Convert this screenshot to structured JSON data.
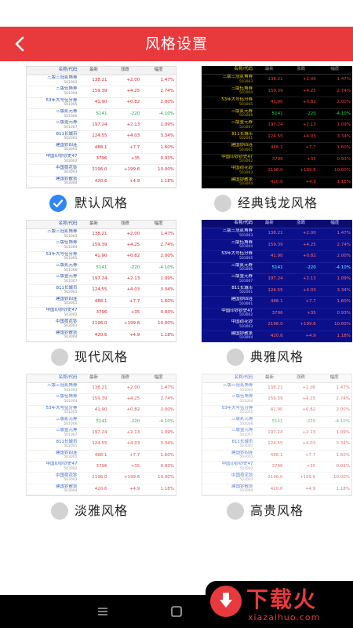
{
  "header": {
    "title": "风格设置",
    "back_icon": "chevron-left-icon"
  },
  "colors": {
    "header_bg": "#e8393d",
    "radio_checked": "#2f86f7",
    "radio_unchecked": "#d2d2d2"
  },
  "table": {
    "headers": [
      "名称/代码",
      "最新",
      "涨跌",
      "幅度"
    ],
    "rows": [
      {
        "name": "三版三冠贰角券",
        "code": "501003",
        "latest": "138.21",
        "change": "+2.00",
        "pct": "1.47%",
        "dir": "up"
      },
      {
        "name": "三版伍角券",
        "code": "501004",
        "latest": "159.39",
        "change": "+4.25",
        "pct": "2.74%",
        "dir": "up"
      },
      {
        "name": "53年大号伍分券",
        "code": "501005",
        "latest": "41.90",
        "change": "+0.82",
        "pct": "2.00%",
        "dir": "up"
      },
      {
        "name": "三版贰元券",
        "code": "501006",
        "latest": "5141",
        "change": "-220",
        "pct": "-4.10%",
        "dir": "down"
      },
      {
        "name": "三版壹元券",
        "code": "501007",
        "latest": "197.24",
        "change": "+2.13",
        "pct": "1.09%",
        "dir": "up"
      },
      {
        "name": "811长城币",
        "code": "502001",
        "latest": "124.55",
        "change": "+4.03",
        "pct": "3.34%",
        "dir": "up"
      },
      {
        "name": "建国钞四连",
        "code": "503001",
        "latest": "488.1",
        "change": "+7.7",
        "pct": "1.60%",
        "dir": "up"
      },
      {
        "name": "中国印钞钞史47",
        "code": "503002",
        "latest": "3796",
        "change": "+35",
        "pct": "0.93%",
        "dir": "up"
      },
      {
        "name": "中国荷花钞",
        "code": "503003",
        "latest": "2196.0",
        "change": "+199.6",
        "pct": "10.00%",
        "dir": "up"
      },
      {
        "name": "建国钞散张",
        "code": "503004",
        "latest": "420.6",
        "change": "+4.9",
        "pct": "1.18%",
        "dir": "up"
      }
    ]
  },
  "themes": [
    {
      "key": "default",
      "label": "默认风格",
      "checked": true
    },
    {
      "key": "classic",
      "label": "经典钱龙风格",
      "checked": false
    },
    {
      "key": "modern",
      "label": "现代风格",
      "checked": false
    },
    {
      "key": "elegant",
      "label": "典雅风格",
      "checked": false
    },
    {
      "key": "light",
      "label": "淡雅风格",
      "checked": false
    },
    {
      "key": "noble",
      "label": "高贵风格",
      "checked": false
    }
  ],
  "watermark": {
    "text": "下载火",
    "url": "xiazaihuo.com"
  }
}
